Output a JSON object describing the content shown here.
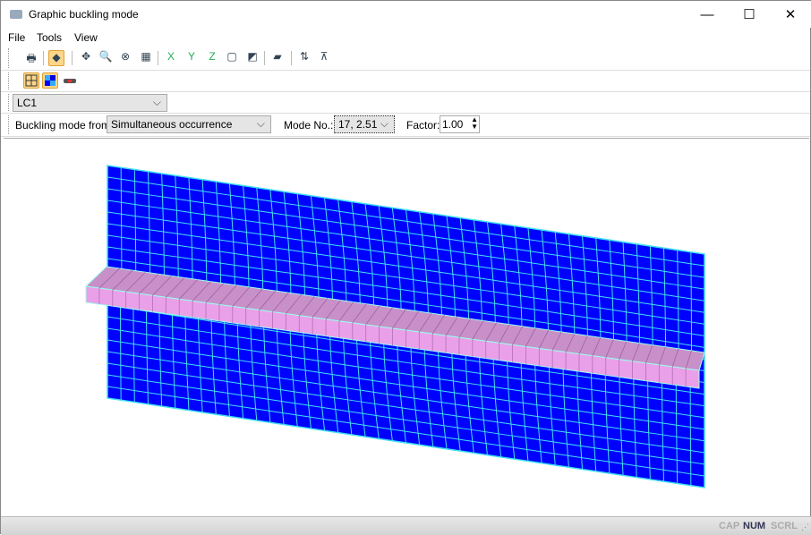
{
  "window": {
    "title": "Graphic buckling mode",
    "minimize": "—",
    "maximize": "☐",
    "close": "✕"
  },
  "menu": [
    "File",
    "Tools",
    "View"
  ],
  "toolbar1_icons": [
    "print-icon",
    "render-icon",
    "view-sep",
    "pan-icon",
    "zoom-icon",
    "zoom-reset-icon",
    "zoom-window-icon",
    "view-x-icon",
    "view-y-icon",
    "view-z-icon",
    "isometric-icon",
    "perspective-icon",
    "wireframe-icon",
    "dimension-icon",
    "scale-icon"
  ],
  "toolbar2_icons": [
    "mesh-icon",
    "color-icon",
    "member-icon"
  ],
  "loadcase": {
    "value": "LC1"
  },
  "controls": {
    "buckling_label": "Buckling mode from:",
    "buckling_value": "Simultaneous occurrence",
    "mode_label": "Mode No.:",
    "mode_value": "17, 2.51",
    "factor_label": "Factor:",
    "factor_value": "1.00"
  },
  "status": {
    "cap": "CAP",
    "num": "NUM",
    "scrl": "SCRL"
  },
  "colors": {
    "plate": "#0000ff",
    "mesh": "#40e0f0",
    "beam": "#eaa0e8"
  }
}
